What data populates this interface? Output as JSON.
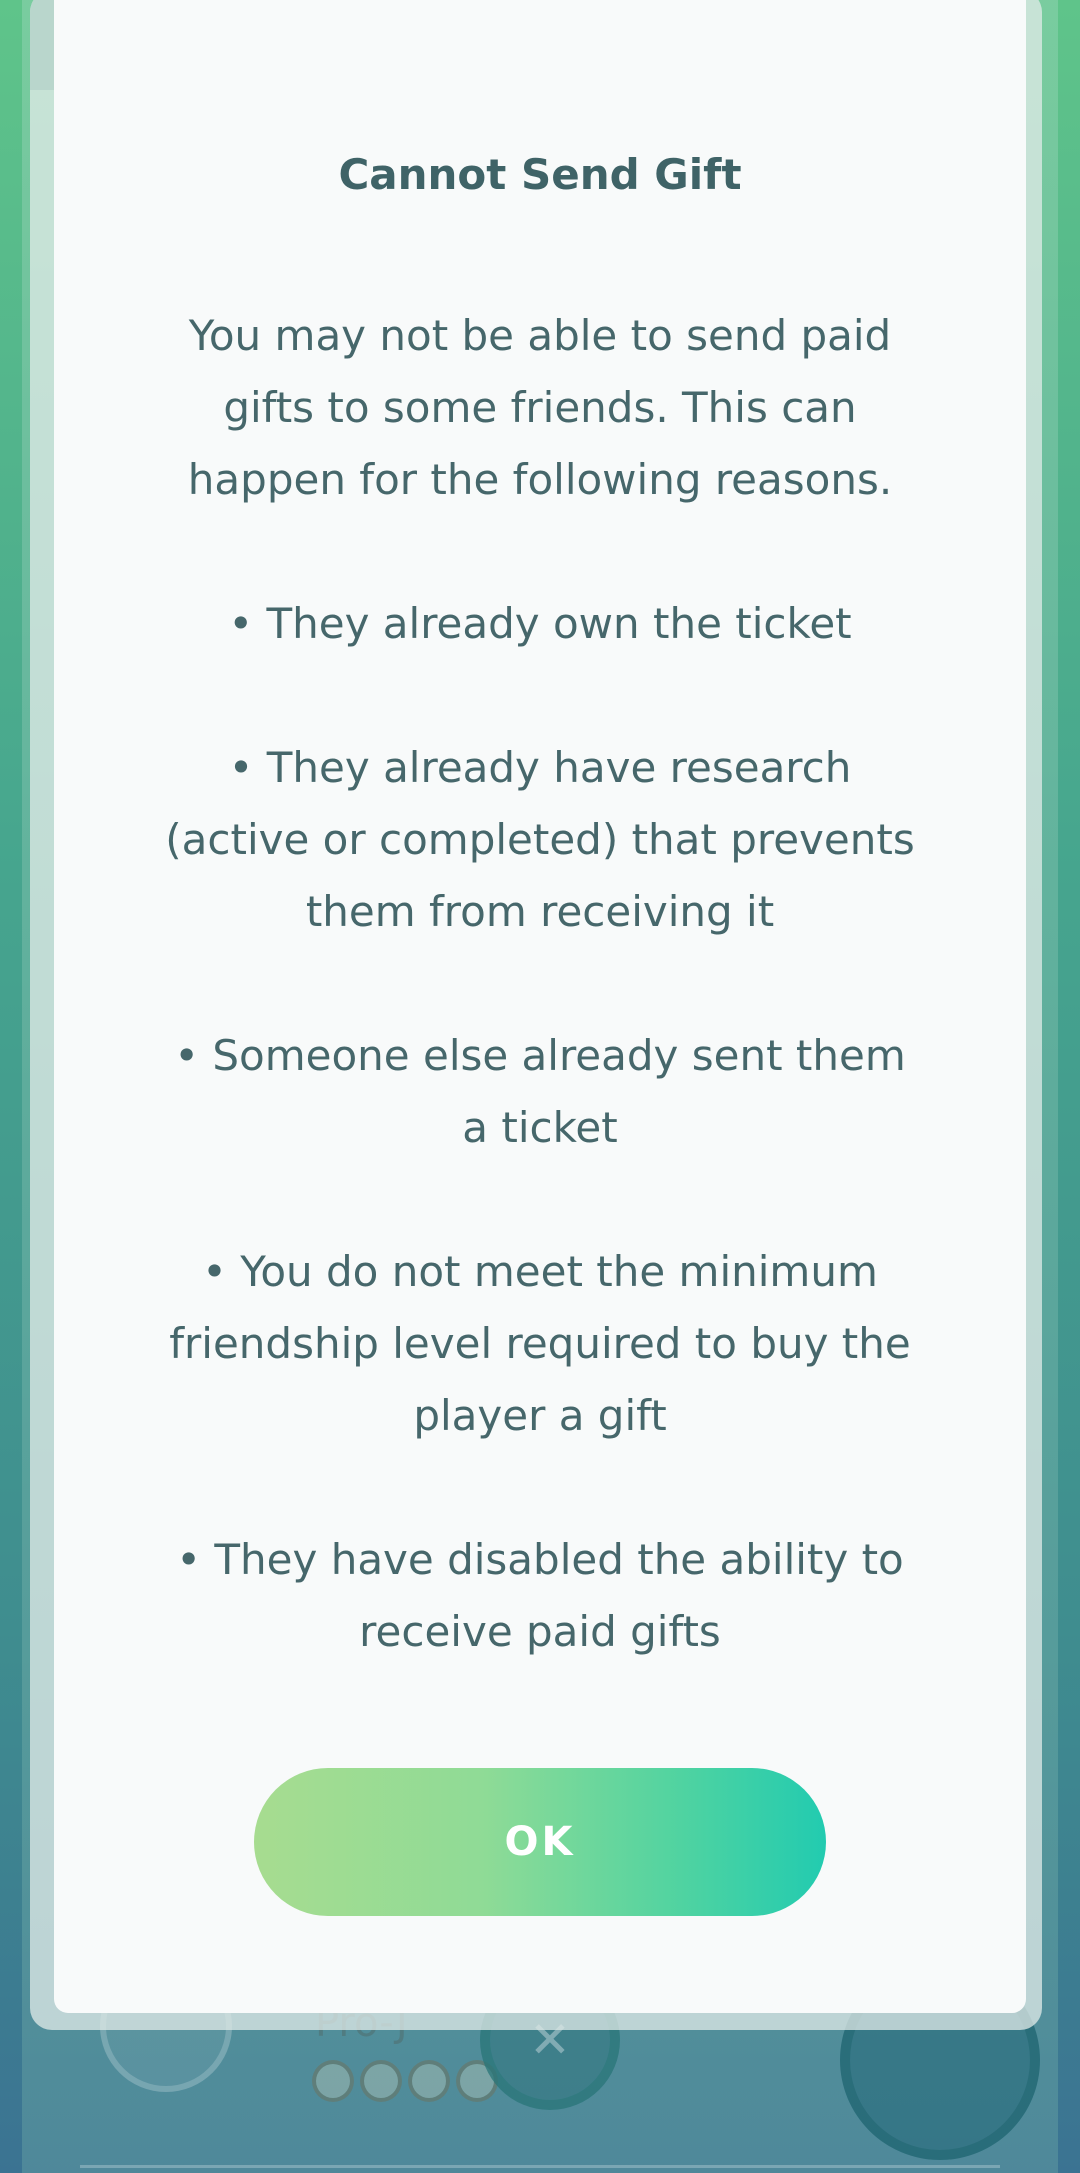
{
  "dialog": {
    "title": "Cannot Send Gift",
    "intro": "You may not be able to send paid gifts to some friends. This can happen for the following reasons.",
    "reasons": [
      "• They already own the ticket",
      "• They already have research (active or completed) that prevents them from receiving it",
      "• Someone else already sent them a ticket",
      "• You do not meet the minimum friendship level required to buy the player a gift",
      "• They have disabled the ability to receive paid gifts"
    ],
    "ok_label": "OK"
  },
  "background": {
    "friend_name": "Pro-J"
  },
  "colors": {
    "title": "#3f6367",
    "body_text": "#46676b",
    "ok_gradient_start": "#a7dc90",
    "ok_gradient_end": "#22cbb0"
  }
}
